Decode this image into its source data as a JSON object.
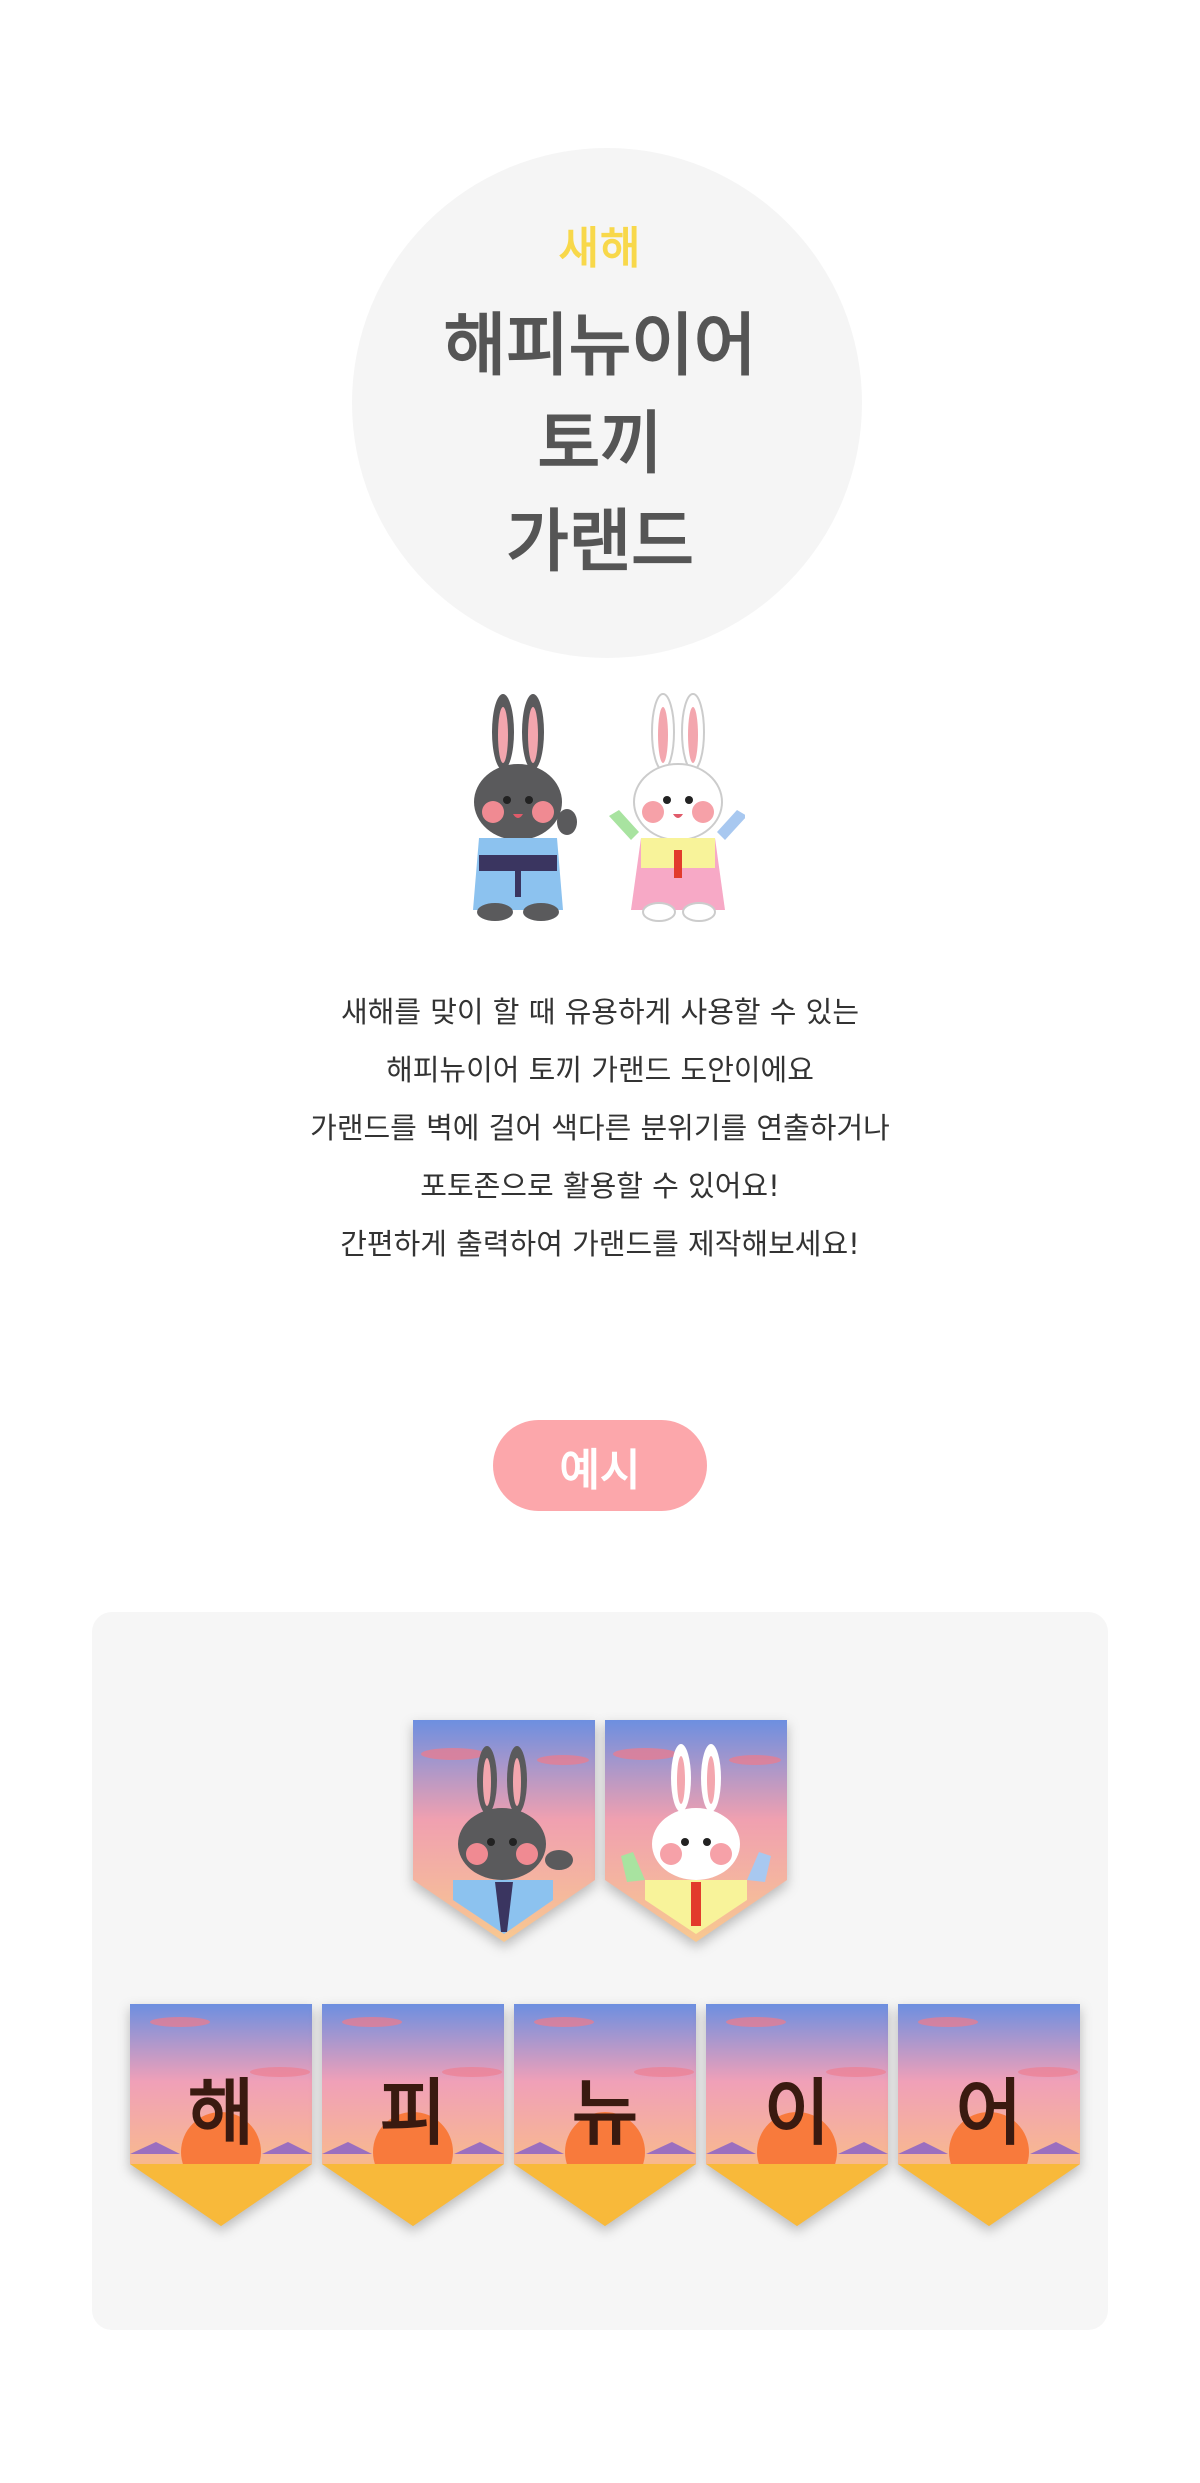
{
  "hero": {
    "subtitle": "새해",
    "title_lines": [
      "해피뉴이어",
      "토끼",
      "가랜드"
    ]
  },
  "description": {
    "lines": [
      "새해를 맞이 할 때 유용하게 사용할 수 있는",
      "해피뉴이어 토끼 가랜드 도안이에요",
      "가랜드를 벽에 걸어 색다른 분위기를 연출하거나",
      "포토존으로 활용할 수 있어요!",
      "간편하게 출력하여 가랜드를 제작해보세요!"
    ]
  },
  "example": {
    "label": "예시",
    "letter_flags": [
      "해",
      "피",
      "뉴",
      "이",
      "어"
    ]
  },
  "colors": {
    "accent_yellow": "#f8d84a",
    "pill_pink": "#fca7ab",
    "title_gray": "#555555"
  }
}
